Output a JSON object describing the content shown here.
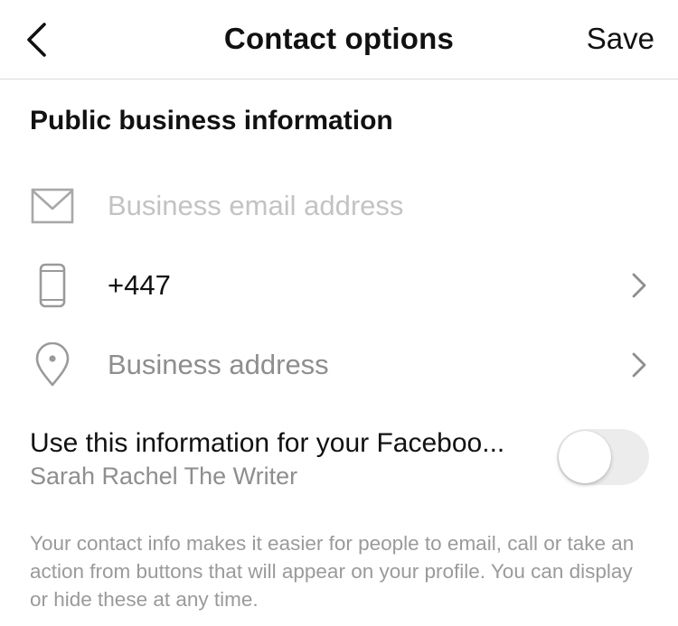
{
  "header": {
    "title": "Contact options",
    "save_label": "Save",
    "back_icon": "chevron-left-icon"
  },
  "section": {
    "title": "Public business information"
  },
  "fields": {
    "email": {
      "placeholder": "Business email address",
      "icon": "mail-icon"
    },
    "phone": {
      "value": "+447",
      "icon": "phone-icon"
    },
    "address": {
      "placeholder": "Business address",
      "icon": "location-pin-icon"
    }
  },
  "facebook": {
    "label": "Use this information for your Faceboo...",
    "page_name": "Sarah Rachel The Writer",
    "enabled": false
  },
  "footer": {
    "note": "Your contact info makes it easier for people to email, call or take an action from buttons that will appear on your profile. You can display or hide these at any time."
  },
  "colors": {
    "text": "#111111",
    "placeholder": "#c3c3c3",
    "muted": "#8e8e8e",
    "divider": "#dbdbdb",
    "toggle_off": "#ececec"
  }
}
